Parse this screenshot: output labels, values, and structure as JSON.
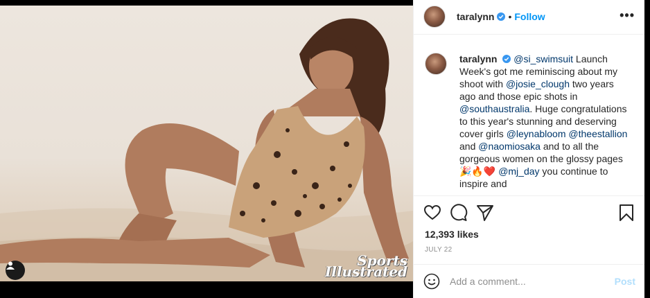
{
  "photo": {
    "alt_icon": "user-tag-icon",
    "watermark_line1": "Sports",
    "watermark_line2": "Illustrated"
  },
  "header": {
    "username": "taralynn",
    "separator": "•",
    "follow_label": "Follow",
    "more_label": "•••"
  },
  "caption": {
    "username": "taralynn",
    "segments": [
      {
        "text": "@si_swimsuit",
        "mention": true
      },
      {
        "text": " Launch Week's got me reminiscing about my shoot with ",
        "mention": false
      },
      {
        "text": "@josie_clough",
        "mention": true
      },
      {
        "text": " two years ago and those epic shots in ",
        "mention": false
      },
      {
        "text": "@southaustralia",
        "mention": true
      },
      {
        "text": ". Huge congratulations to this year's stunning and deserving cover girls ",
        "mention": false
      },
      {
        "text": "@leynabloom",
        "mention": true
      },
      {
        "text": " ",
        "mention": false
      },
      {
        "text": "@theestallion",
        "mention": true
      },
      {
        "text": " and ",
        "mention": false
      },
      {
        "text": "@naomiosaka",
        "mention": true
      },
      {
        "text": " and to all the gorgeous women on the glossy pages 🎉🔥❤️ ",
        "mention": false
      },
      {
        "text": "@mj_day",
        "mention": true
      },
      {
        "text": " you continue to inspire and",
        "mention": false
      }
    ]
  },
  "stats": {
    "likes": "12,393 likes",
    "date": "JULY 22"
  },
  "comment_box": {
    "placeholder": "Add a comment...",
    "post_label": "Post"
  },
  "colors": {
    "accent": "#0095f6",
    "mention": "#00376b",
    "post_disabled": "#b2dffc",
    "muted": "#8e8e8e"
  }
}
